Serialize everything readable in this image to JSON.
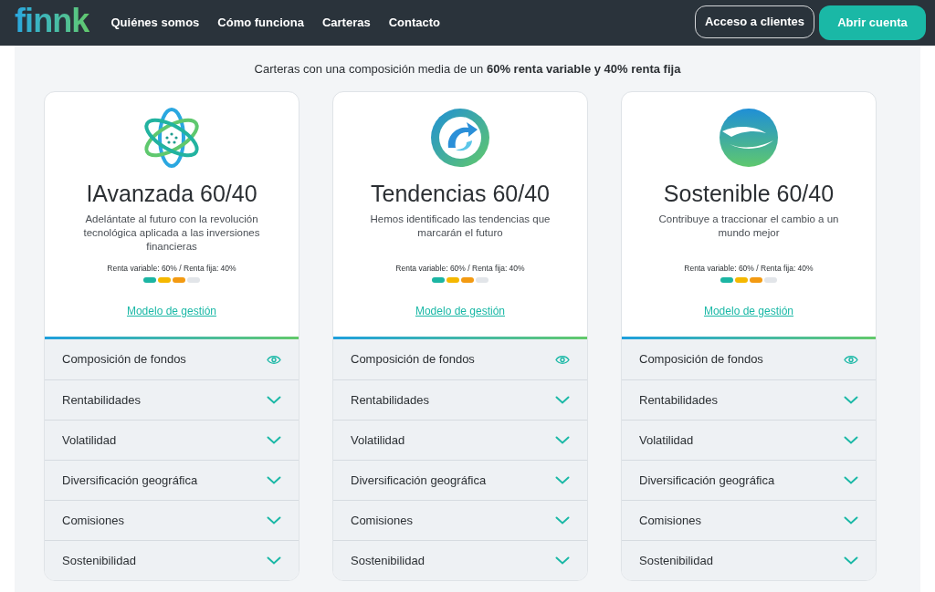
{
  "header": {
    "logo": "finnk",
    "nav": [
      "Quiénes somos",
      "Cómo funciona",
      "Carteras",
      "Contacto"
    ],
    "buttons": [
      {
        "label": "Acceso a clientes",
        "kind": "outline"
      },
      {
        "label": "Abrir cuenta",
        "kind": "primary"
      }
    ]
  },
  "subtitle": "Carteras con una composición media de un **60% renta variable y 40% renta fija**",
  "cards": [
    {
      "kind": "atom",
      "title": "IAvanzada 60/40",
      "description": "Adelántate al futuro con la revolución tecnológica aplicada a las inversiones financieras",
      "allocation": "Renta variable: 60% / Renta fija: 40%",
      "risk": [
        {
          "color": "#1cb5a3"
        },
        {
          "color": "#f5b800"
        },
        {
          "color": "#f39a12"
        },
        {
          "color": "#e2e5e9"
        }
      ],
      "link": "Modelo de gestión",
      "sections": [
        {
          "label": "Composición de fondos",
          "kind": "eye"
        },
        {
          "label": "Rentabilidades",
          "kind": "chevron"
        },
        {
          "label": "Volatilidad",
          "kind": "chevron"
        },
        {
          "label": "Diversificación geográfica",
          "kind": "chevron"
        },
        {
          "label": "Comisiones",
          "kind": "chevron"
        },
        {
          "label": "Sostenibilidad",
          "kind": "chevron"
        }
      ]
    },
    {
      "kind": "arrow",
      "title": "Tendencias 60/40",
      "description": "Hemos identificado las tendencias que marcarán el futuro",
      "allocation": "Renta variable: 60% / Renta fija: 40%",
      "risk": [
        {
          "color": "#1cb5a3"
        },
        {
          "color": "#f5b800"
        },
        {
          "color": "#f39a12"
        },
        {
          "color": "#e2e5e9"
        }
      ],
      "link": "Modelo de gestión",
      "sections": [
        {
          "label": "Composición de fondos",
          "kind": "eye"
        },
        {
          "label": "Rentabilidades",
          "kind": "chevron"
        },
        {
          "label": "Volatilidad",
          "kind": "chevron"
        },
        {
          "label": "Diversificación geográfica",
          "kind": "chevron"
        },
        {
          "label": "Comisiones",
          "kind": "chevron"
        },
        {
          "label": "Sostenibilidad",
          "kind": "chevron"
        }
      ]
    },
    {
      "kind": "globe",
      "title": "Sostenible 60/40",
      "description": "Contribuye a traccionar el cambio a un mundo mejor",
      "allocation": "Renta variable: 60% / Renta fija: 40%",
      "risk": [
        {
          "color": "#1cb5a3"
        },
        {
          "color": "#f5b800"
        },
        {
          "color": "#f39a12"
        },
        {
          "color": "#e2e5e9"
        }
      ],
      "link": "Modelo de gestión",
      "sections": [
        {
          "label": "Composición de fondos",
          "kind": "eye"
        },
        {
          "label": "Rentabilidades",
          "kind": "chevron"
        },
        {
          "label": "Volatilidad",
          "kind": "chevron"
        },
        {
          "label": "Diversificación geográfica",
          "kind": "chevron"
        },
        {
          "label": "Comisiones",
          "kind": "chevron"
        },
        {
          "label": "Sostenibilidad",
          "kind": "chevron"
        }
      ]
    }
  ]
}
